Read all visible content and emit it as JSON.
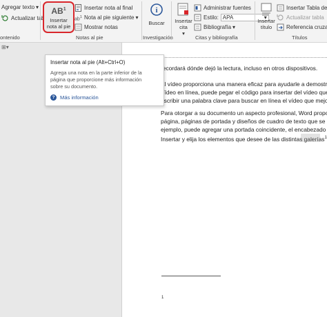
{
  "ribbon": {
    "group1": {
      "add_text": "Agregar texto",
      "update_table": "Actualizar tabla",
      "group_label": "ontenido"
    },
    "footnotes": {
      "insert_footnote_line1": "Insertar",
      "insert_footnote_line2": "nota al pie",
      "insert_endnote": "Insertar nota al final",
      "next_footnote": "Nota al pie siguiente",
      "show_notes": "Mostrar notas",
      "group_label": "Notas al pie"
    },
    "research": {
      "search": "Buscar",
      "group_label": "Investigación"
    },
    "citations": {
      "insert_citation_line1": "Insertar",
      "insert_citation_line2": "cita",
      "manage_sources": "Administrar fuentes",
      "style_label": "Estilo:",
      "style_value": "APA",
      "bibliography": "Bibliografía",
      "group_label": "Citas y bibliografía"
    },
    "captions": {
      "insert_caption_line1": "Insertar",
      "insert_caption_line2": "título",
      "insert_table_of_figures": "Insertar Tabla de",
      "update_table": "Actualizar tabla",
      "cross_reference": "Referencia cruzad",
      "group_label": "Títulos"
    }
  },
  "tooltip": {
    "title": "Insertar nota al pie (Alt+Ctrl+O)",
    "line1": "Agrega una nota en la parte inferior de la",
    "line2": "página que proporcione más información",
    "line3": "sobre su documento.",
    "more_info": "Más información"
  },
  "document": {
    "p0": "recordará dónde dejó la lectura, incluso en otros dispositivos.",
    "p1": [
      "El vídeo proporciona una manera eficaz para ayudarle a demostr",
      "Vídeo en línea, puede pegar el código para insertar del vídeo que",
      "escribir una palabra clave para buscar en línea el vídeo que mejor"
    ],
    "p2": [
      "Para otorgar a su documento un aspecto profesional, Word propor",
      "página, páginas de portada y diseños de cuadro de texto que se c",
      "ejemplo, puede agregar una portada coincidente, el encabezado y",
      "Insertar y elija los elementos que desee de las distintas galerías"
    ],
    "footnote_ref": "1",
    "footnote_number": "1"
  },
  "colors": {
    "highlight_red": "#d9262b",
    "link_blue": "#2b579a",
    "ribbon_bg": "#f3f3f3"
  }
}
